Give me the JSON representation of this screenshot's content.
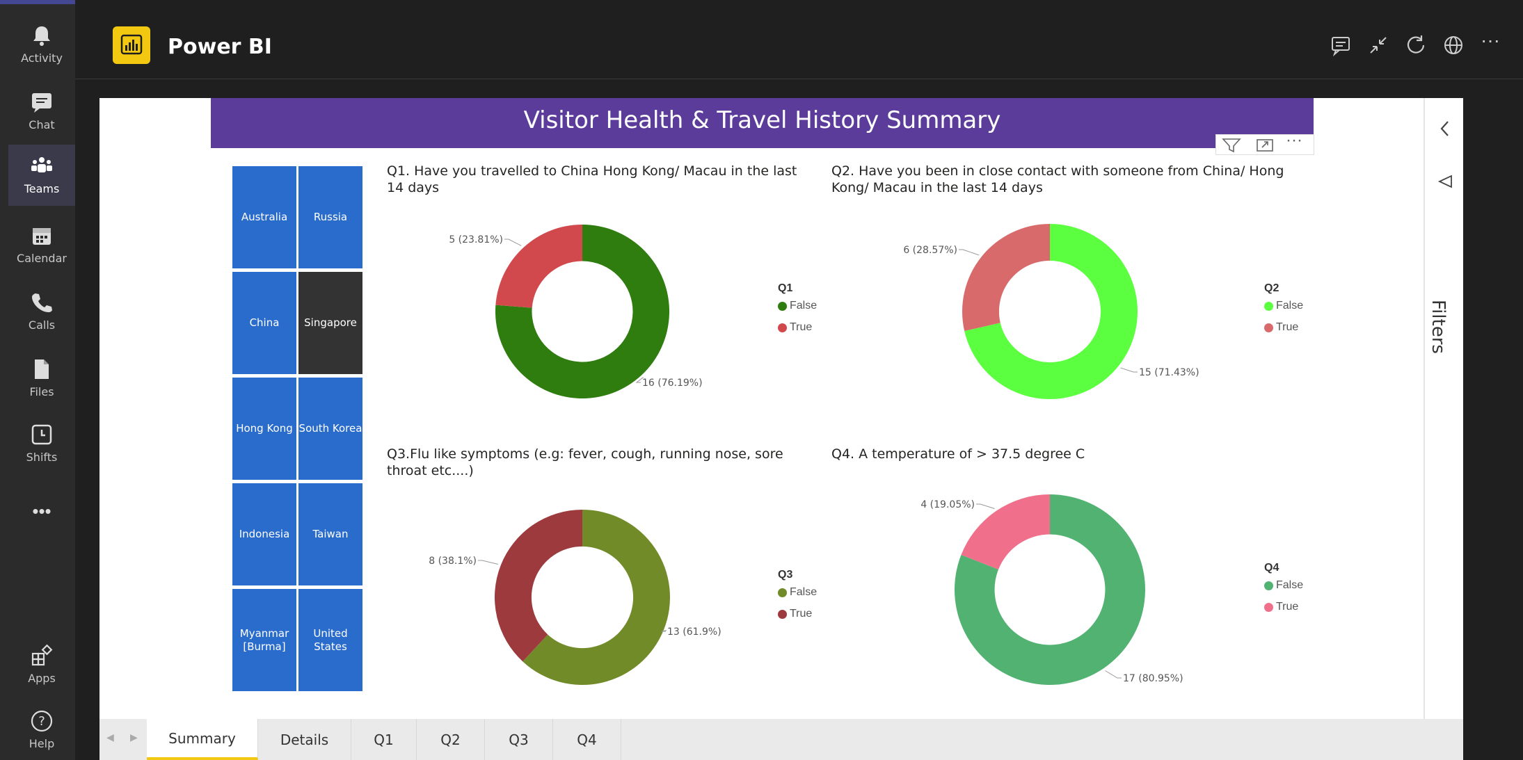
{
  "rail": {
    "items": [
      {
        "label": "Activity",
        "icon": "bell-icon"
      },
      {
        "label": "Chat",
        "icon": "chat-icon"
      },
      {
        "label": "Teams",
        "icon": "teams-icon"
      },
      {
        "label": "Calendar",
        "icon": "calendar-icon"
      },
      {
        "label": "Calls",
        "icon": "phone-icon"
      },
      {
        "label": "Files",
        "icon": "file-icon"
      },
      {
        "label": "Shifts",
        "icon": "clock-icon"
      }
    ],
    "more_label": "•••",
    "bottom_items": [
      {
        "label": "Apps",
        "icon": "apps-icon"
      },
      {
        "label": "Help",
        "icon": "help-icon"
      }
    ]
  },
  "header": {
    "app_title": "Power BI",
    "more_label": "···"
  },
  "report": {
    "title": "Visitor Health & Travel History Summary",
    "visual_actions_more": "···",
    "treemap": [
      {
        "label": "Australia"
      },
      {
        "label": "Russia"
      },
      {
        "label": "China"
      },
      {
        "label": "Singapore"
      },
      {
        "label": "Hong Kong"
      },
      {
        "label": "South Korea"
      },
      {
        "label": "Indonesia"
      },
      {
        "label": "Taiwan"
      },
      {
        "label": "Myanmar [Burma]"
      },
      {
        "label": "United States"
      }
    ],
    "filters_label": "Filters"
  },
  "chart_data": [
    {
      "type": "pie",
      "title": "Q1. Have you travelled to China Hong Kong/ Macau in the last 14 days",
      "legend_title": "Q1",
      "categories": [
        "False",
        "True"
      ],
      "values": [
        16,
        5
      ],
      "data_labels": [
        "16 (76.19%)",
        "5 (23.81%)"
      ],
      "colors": [
        "#2e7d0e",
        "#d2494d"
      ],
      "legend": "right"
    },
    {
      "type": "pie",
      "title": "Q2. Have you been in close contact with someone from China/ Hong Kong/ Macau in the last 14 days",
      "legend_title": "Q2",
      "categories": [
        "False",
        "True"
      ],
      "values": [
        15,
        6
      ],
      "data_labels": [
        "15 (71.43%)",
        "6 (28.57%)"
      ],
      "colors": [
        "#5cff3f",
        "#d96a6c"
      ],
      "legend": "right"
    },
    {
      "type": "pie",
      "title": "Q3.Flu like symptoms (e.g: fever, cough, running nose, sore throat etc....)",
      "legend_title": "Q3",
      "categories": [
        "False",
        "True"
      ],
      "values": [
        13,
        8
      ],
      "data_labels": [
        "13 (61.9%)",
        "8 (38.1%)"
      ],
      "colors": [
        "#718b29",
        "#9c3a3d"
      ],
      "legend": "right"
    },
    {
      "type": "pie",
      "title": "Q4. A temperature of > 37.5 degree C",
      "legend_title": "Q4",
      "categories": [
        "False",
        "True"
      ],
      "values": [
        17,
        4
      ],
      "data_labels": [
        "17 (80.95%)",
        "4 (19.05%)"
      ],
      "colors": [
        "#52b272",
        "#f06f8a"
      ],
      "legend": "right"
    }
  ],
  "tabs": [
    {
      "label": "Summary",
      "active": true
    },
    {
      "label": "Details",
      "active": false
    },
    {
      "label": "Q1",
      "active": false
    },
    {
      "label": "Q2",
      "active": false
    },
    {
      "label": "Q3",
      "active": false
    },
    {
      "label": "Q4",
      "active": false
    }
  ],
  "colors": {
    "rail_bg": "#2b2b2b",
    "header_bg": "#1f1f1f",
    "banner": "#5b3c9a",
    "tile": "#2a6ccb",
    "tile_selected": "#333333",
    "tab_accent": "#f2c811"
  }
}
